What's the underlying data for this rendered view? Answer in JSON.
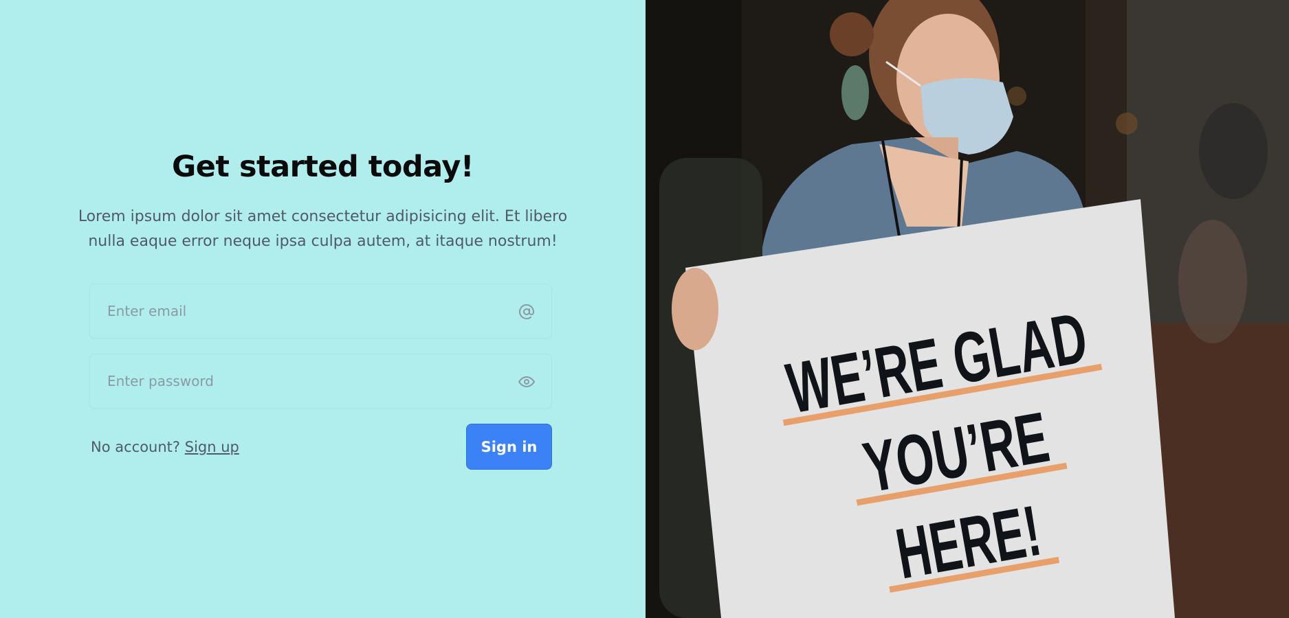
{
  "form": {
    "title": "Get started today!",
    "subtitle": "Lorem ipsum dolor sit amet consectetur adipisicing elit. Et libero nulla eaque error neque ipsa culpa autem, at itaque nostrum!",
    "email_placeholder": "Enter email",
    "password_placeholder": "Enter password",
    "no_account_text": "No account?",
    "signup_label": "Sign up",
    "signin_label": "Sign in",
    "email_icon": "at-icon",
    "password_icon": "eye-icon"
  },
  "photo": {
    "sign_lines": [
      "WE’RE GLAD",
      "YOU’RE",
      "HERE!"
    ]
  },
  "colors": {
    "left_background": "#b0eeee",
    "primary_button": "#3b82f6",
    "sign_underline": "#e8a06a"
  }
}
